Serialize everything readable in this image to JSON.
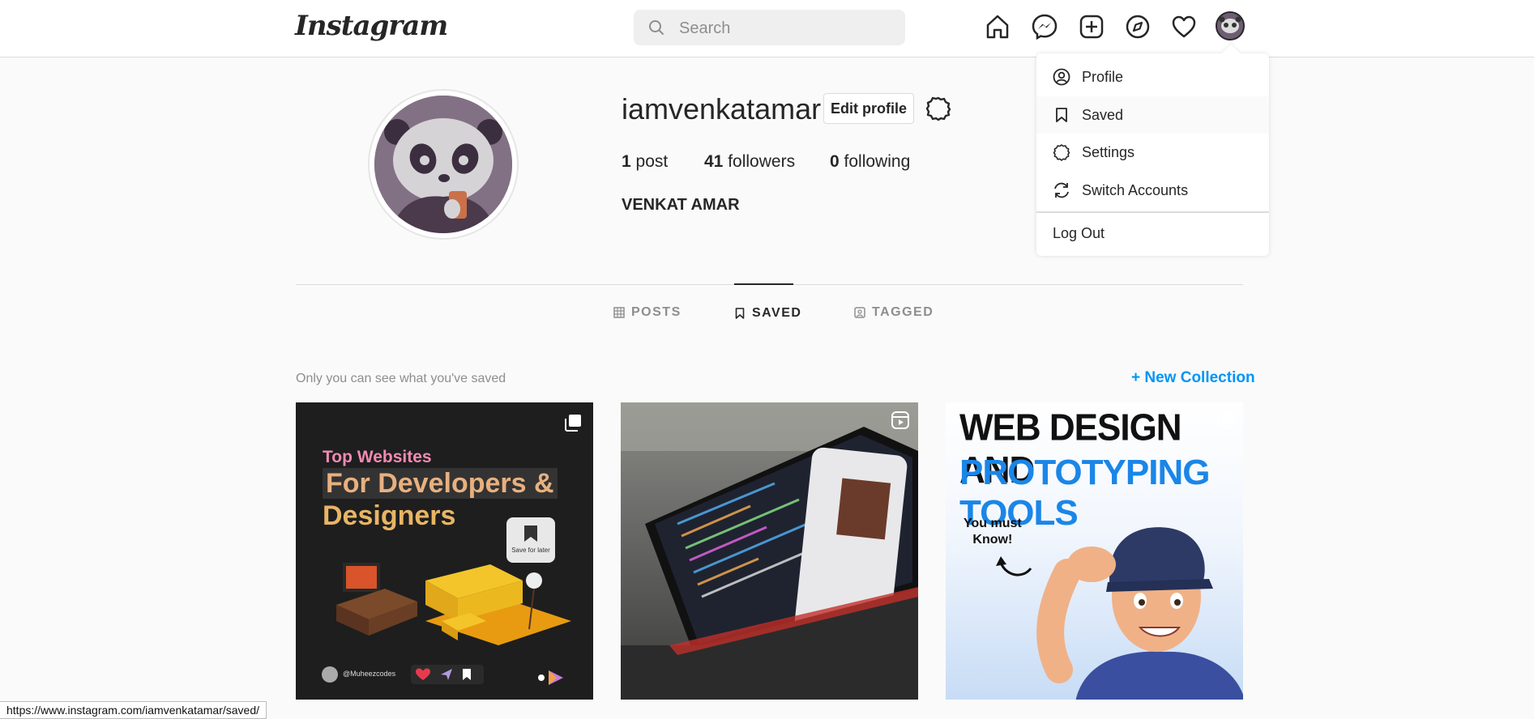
{
  "nav": {
    "logo": "Instagram",
    "search_placeholder": "Search",
    "icons": [
      "home-icon",
      "messenger-icon",
      "new-post-icon",
      "explore-icon",
      "activity-heart-icon"
    ]
  },
  "profile": {
    "username": "iamvenkatamar",
    "edit_label": "Edit profile",
    "posts_count": "1",
    "posts_label": "post",
    "followers_count": "41",
    "followers_label": "followers",
    "following_count": "0",
    "following_label": "following",
    "full_name": "VENKAT AMAR"
  },
  "tabs": [
    {
      "label": "POSTS",
      "active": false
    },
    {
      "label": "SAVED",
      "active": true
    },
    {
      "label": "TAGGED",
      "active": false
    }
  ],
  "saved": {
    "note": "Only you can see what you've saved",
    "new_collection": "+ New Collection"
  },
  "tiles": [
    {
      "small_title": "Top Websites",
      "big_line1": "For Developers &",
      "big_line2": "Designers",
      "save_later": "Save for later",
      "handle": "@Muheezcodes"
    },
    {},
    {
      "line1": "WEB DESIGN AND",
      "line2": "PROTOTYPING TOOLS",
      "must_know_1": "You must",
      "must_know_2": "Know!"
    }
  ],
  "dropdown": {
    "items": [
      {
        "label": "Profile",
        "icon": "profile-icon"
      },
      {
        "label": "Saved",
        "icon": "bookmark-icon"
      },
      {
        "label": "Settings",
        "icon": "settings-icon"
      },
      {
        "label": "Switch Accounts",
        "icon": "switch-icon"
      }
    ],
    "logout": "Log Out"
  },
  "status_url": "https://www.instagram.com/iamvenkatamar/saved/",
  "colors": {
    "accent": "#0095f6",
    "text": "#262626",
    "muted": "#8e8e8e"
  }
}
